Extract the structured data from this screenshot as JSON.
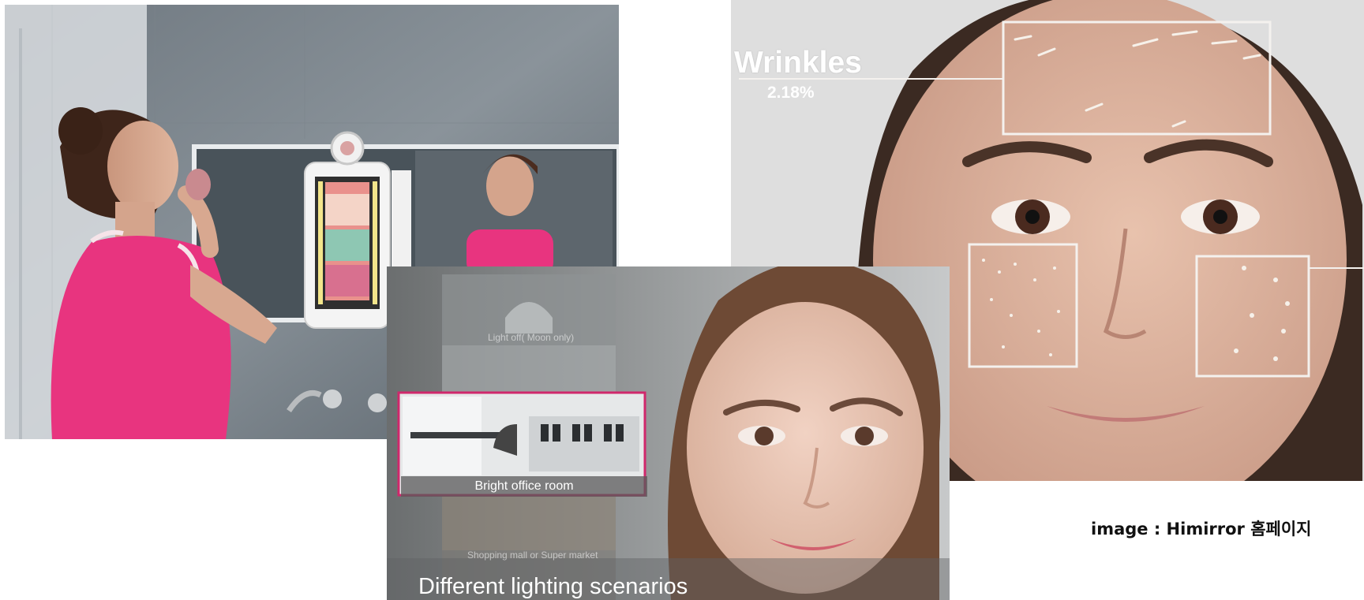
{
  "analysis": {
    "metric_label": "Wrinkles",
    "metric_value": "2.18%"
  },
  "lighting": {
    "caption": "Different lighting scenarios",
    "selected_scene": "Bright office room",
    "scene_top": "Light off( Moon only)",
    "scene_bottom": "Shopping mall or Super market"
  },
  "credit": {
    "text": "image : Himirror 홈페이지"
  },
  "colors": {
    "tank_top": "#e8347f",
    "frame_highlight": "#d0286c",
    "mirror_glow": "#f3e58b"
  }
}
